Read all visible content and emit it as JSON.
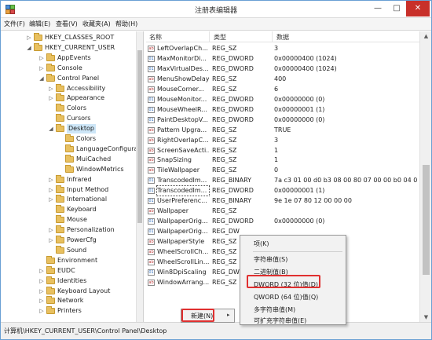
{
  "window": {
    "title": "注册表编辑器",
    "min_glyph": "—",
    "max_glyph": "□",
    "close_glyph": "✕"
  },
  "menu": [
    "文件(F)",
    "编辑(E)",
    "查看(V)",
    "收藏夹(A)",
    "帮助(H)"
  ],
  "tree": [
    {
      "label": "HKEY_CLASSES_ROOT",
      "expander": "▷",
      "selected": false
    },
    {
      "label": "HKEY_CURRENT_USER",
      "expander": "◢",
      "selected": false
    },
    {
      "label": "AppEvents",
      "expander": "▷",
      "selected": false
    },
    {
      "label": "Console",
      "expander": "▷",
      "selected": false
    },
    {
      "label": "Control Panel",
      "expander": "◢",
      "selected": false
    },
    {
      "label": "Accessibility",
      "expander": "▷",
      "selected": false
    },
    {
      "label": "Appearance",
      "expander": "▷",
      "selected": false
    },
    {
      "label": "Colors",
      "expander": "",
      "selected": false
    },
    {
      "label": "Cursors",
      "expander": "",
      "selected": false
    },
    {
      "label": "Desktop",
      "expander": "◢",
      "selected": true
    },
    {
      "label": "Colors",
      "expander": "",
      "selected": false
    },
    {
      "label": "LanguageConfiguratio",
      "expander": "",
      "selected": false
    },
    {
      "label": "MuiCached",
      "expander": "",
      "selected": false
    },
    {
      "label": "WindowMetrics",
      "expander": "",
      "selected": false
    },
    {
      "label": "Infrared",
      "expander": "▷",
      "selected": false
    },
    {
      "label": "Input Method",
      "expander": "▷",
      "selected": false
    },
    {
      "label": "International",
      "expander": "▷",
      "selected": false
    },
    {
      "label": "Keyboard",
      "expander": "",
      "selected": false
    },
    {
      "label": "Mouse",
      "expander": "",
      "selected": false
    },
    {
      "label": "Personalization",
      "expander": "▷",
      "selected": false
    },
    {
      "label": "PowerCfg",
      "expander": "▷",
      "selected": false
    },
    {
      "label": "Sound",
      "expander": "",
      "selected": false
    },
    {
      "label": "Environment",
      "expander": "",
      "selected": false
    },
    {
      "label": "EUDC",
      "expander": "▷",
      "selected": false
    },
    {
      "label": "Identities",
      "expander": "▷",
      "selected": false
    },
    {
      "label": "Keyboard Layout",
      "expander": "▷",
      "selected": false
    },
    {
      "label": "Network",
      "expander": "▷",
      "selected": false
    },
    {
      "label": "Printers",
      "expander": "▷",
      "selected": false
    }
  ],
  "list": {
    "headers": {
      "name": "名称",
      "type": "类型",
      "data": "数据"
    },
    "rows": [
      {
        "name": "LeftOverlapCh...",
        "type": "REG_SZ",
        "data": "3",
        "icon": "ab"
      },
      {
        "name": "MaxMonitorDi...",
        "type": "REG_DWORD",
        "data": "0x00000400 (1024)",
        "icon": "01"
      },
      {
        "name": "MaxVirtualDes...",
        "type": "REG_DWORD",
        "data": "0x00000400 (1024)",
        "icon": "01"
      },
      {
        "name": "MenuShowDelay",
        "type": "REG_SZ",
        "data": "400",
        "icon": "ab"
      },
      {
        "name": "MouseCorner...",
        "type": "REG_SZ",
        "data": "6",
        "icon": "ab"
      },
      {
        "name": "MouseMonitor...",
        "type": "REG_DWORD",
        "data": "0x00000000 (0)",
        "icon": "01"
      },
      {
        "name": "MouseWheelR...",
        "type": "REG_DWORD",
        "data": "0x00000001 (1)",
        "icon": "01"
      },
      {
        "name": "PaintDesktopV...",
        "type": "REG_DWORD",
        "data": "0x00000000 (0)",
        "icon": "01"
      },
      {
        "name": "Pattern Upgra...",
        "type": "REG_SZ",
        "data": "TRUE",
        "icon": "ab"
      },
      {
        "name": "RightOverlapC...",
        "type": "REG_SZ",
        "data": "3",
        "icon": "ab"
      },
      {
        "name": "ScreenSaveActi...",
        "type": "REG_SZ",
        "data": "1",
        "icon": "ab"
      },
      {
        "name": "SnapSizing",
        "type": "REG_SZ",
        "data": "1",
        "icon": "ab"
      },
      {
        "name": "TileWallpaper",
        "type": "REG_SZ",
        "data": "0",
        "icon": "ab"
      },
      {
        "name": "TranscodedIm...",
        "type": "REG_BINARY",
        "data": "7a c3 01 00 d0 b3 08 00 80 07 00 00 b0 04 0...",
        "icon": "01"
      },
      {
        "name": "TranscodedIm...",
        "type": "REG_DWORD",
        "data": "0x00000001 (1)",
        "icon": "01"
      },
      {
        "name": "UserPreferenc...",
        "type": "REG_BINARY",
        "data": "9e 1e 07 80 12 00 00 00",
        "icon": "01"
      },
      {
        "name": "Wallpaper",
        "type": "REG_SZ",
        "data": "",
        "icon": "ab"
      },
      {
        "name": "WallpaperOrig...",
        "type": "REG_DWORD",
        "data": "0x00000000 (0)",
        "icon": "01"
      },
      {
        "name": "WallpaperOrig...",
        "type": "REG_DW",
        "data": "",
        "icon": "01"
      },
      {
        "name": "WallpaperStyle",
        "type": "REG_SZ",
        "data": "",
        "icon": "ab"
      },
      {
        "name": "WheelScrollCh...",
        "type": "REG_SZ",
        "data": "",
        "icon": "ab"
      },
      {
        "name": "WheelScrollLin...",
        "type": "REG_SZ",
        "data": "",
        "icon": "ab"
      },
      {
        "name": "Win8DpiScaling",
        "type": "REG_DW",
        "data": "",
        "icon": "01"
      },
      {
        "name": "WindowArrang...",
        "type": "REG_SZ",
        "data": "",
        "icon": "ab"
      }
    ],
    "focused_row": 14
  },
  "context_menu": {
    "new_label": "新建(N)",
    "arrow": "▸"
  },
  "submenu": [
    "项(K)",
    "字符串值(S)",
    "二进制值(B)",
    "DWORD (32 位)值(D)",
    "QWORD (64 位)值(Q)",
    "多字符串值(M)",
    "可扩充字符串值(E)"
  ],
  "status": "计算机\\HKEY_CURRENT_USER\\Control Panel\\Desktop",
  "colors": {
    "highlight": "#e03030",
    "selection": "#cde6f7",
    "folder": "#e8c060"
  }
}
